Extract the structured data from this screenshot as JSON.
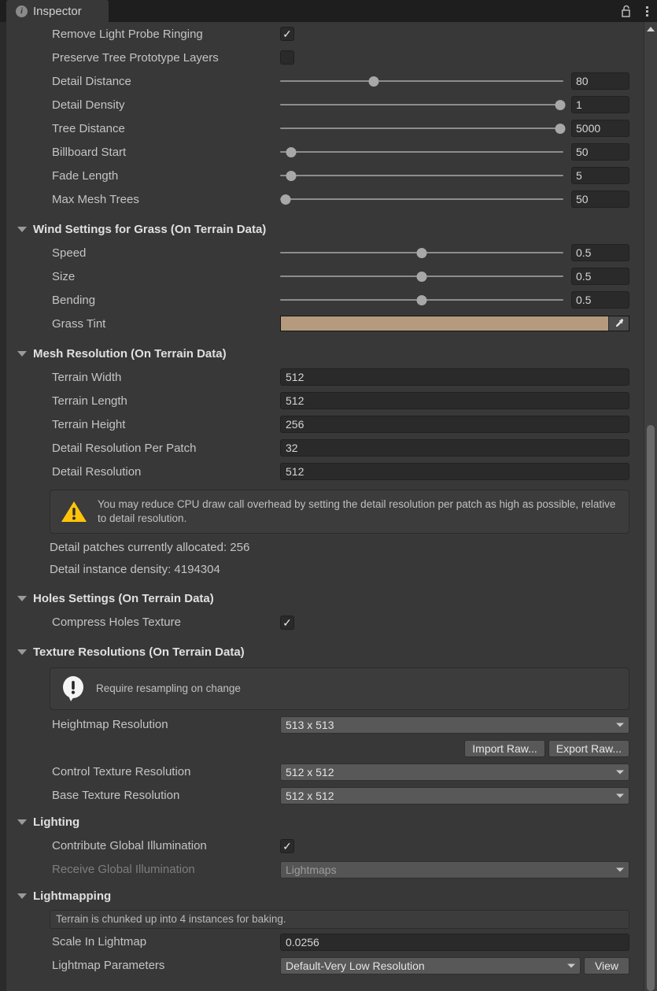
{
  "window": {
    "tab_label": "Inspector",
    "tab_icon": "info-circle-icon",
    "lock_icon": "padlock-unlocked-icon",
    "menu_icon": "kebab-menu-icon",
    "accent_color": "#2c6fd1",
    "background_color": "#383838"
  },
  "scrollbar": {
    "up_arrow": "chevron-up-icon"
  },
  "top_rows": [
    {
      "label": "Remove Light Probe Ringing",
      "type": "checkbox",
      "checked": true
    },
    {
      "label": "Preserve Tree Prototype Layers",
      "type": "checkbox",
      "checked": false
    },
    {
      "label": "Detail Distance",
      "type": "slider",
      "value": "80",
      "knob_pct": 33
    },
    {
      "label": "Detail Density",
      "type": "slider",
      "value": "1",
      "knob_pct": 99
    },
    {
      "label": "Tree Distance",
      "type": "slider",
      "value": "5000",
      "knob_pct": 99
    },
    {
      "label": "Billboard Start",
      "type": "slider",
      "value": "50",
      "knob_pct": 4
    },
    {
      "label": "Fade Length",
      "type": "slider",
      "value": "5",
      "knob_pct": 4
    },
    {
      "label": "Max Mesh Trees",
      "type": "slider",
      "value": "50",
      "knob_pct": 2
    }
  ],
  "wind_settings": {
    "header": "Wind Settings for Grass (On Terrain Data)",
    "rows": [
      {
        "label": "Speed",
        "type": "slider",
        "value": "0.5",
        "knob_pct": 50
      },
      {
        "label": "Size",
        "type": "slider",
        "value": "0.5",
        "knob_pct": 50
      },
      {
        "label": "Bending",
        "type": "slider",
        "value": "0.5",
        "knob_pct": 50
      }
    ],
    "grass_tint": {
      "label": "Grass Tint",
      "color": "#b59a7e",
      "eyedropper_icon": "eyedropper-icon"
    }
  },
  "mesh_resolution": {
    "header": "Mesh Resolution (On Terrain Data)",
    "rows": [
      {
        "label": "Terrain Width",
        "value": "512"
      },
      {
        "label": "Terrain Length",
        "value": "512"
      },
      {
        "label": "Terrain Height",
        "value": "256"
      },
      {
        "label": "Detail Resolution Per Patch",
        "value": "32"
      },
      {
        "label": "Detail Resolution",
        "value": "512"
      }
    ],
    "warning": {
      "icon": "warning-triangle-icon",
      "color": "#ffc107",
      "text": "You may reduce CPU draw call overhead by setting the detail resolution per patch as high as possible, relative to detail resolution."
    },
    "info_lines": [
      "Detail patches currently allocated: 256",
      "Detail instance density: 4194304"
    ]
  },
  "holes_settings": {
    "header": "Holes Settings (On Terrain Data)",
    "rows": [
      {
        "label": "Compress Holes Texture",
        "type": "checkbox",
        "checked": true
      }
    ]
  },
  "texture_resolutions": {
    "header": "Texture Resolutions (On Terrain Data)",
    "notice": {
      "icon": "info-speech-bubble-icon",
      "text": "Require resampling on change"
    },
    "heightmap": {
      "label": "Heightmap Resolution",
      "value": "513 x 513"
    },
    "buttons": [
      {
        "label": "Import Raw..."
      },
      {
        "label": "Export Raw..."
      }
    ],
    "control_texture": {
      "label": "Control Texture Resolution",
      "value": "512 x 512"
    },
    "base_texture": {
      "label": "Base Texture Resolution",
      "value": "512 x 512"
    }
  },
  "lighting": {
    "header": "Lighting",
    "contribute_gi": {
      "label": "Contribute Global Illumination",
      "checked": true
    },
    "receive_gi": {
      "label": "Receive Global Illumination",
      "value": "Lightmaps",
      "disabled": true
    }
  },
  "lightmapping": {
    "header": "Lightmapping",
    "notice": "Terrain is chunked up into 4 instances for baking.",
    "scale_in_lightmap": {
      "label": "Scale In Lightmap",
      "value": "0.0256"
    },
    "lightmap_parameters": {
      "label": "Lightmap Parameters",
      "value": "Default-Very Low Resolution",
      "button": "View"
    }
  }
}
